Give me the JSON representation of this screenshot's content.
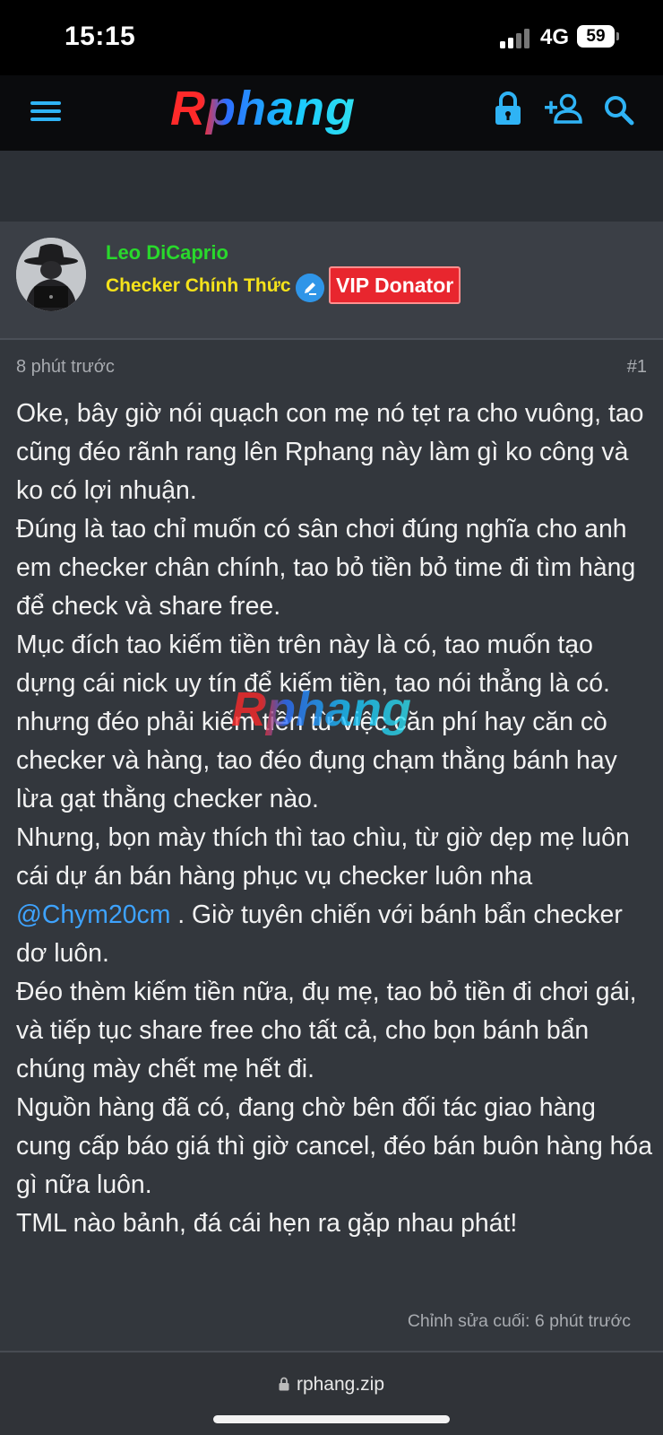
{
  "status_bar": {
    "time": "15:15",
    "network": "4G",
    "battery": "59"
  },
  "navbar": {
    "logo_text": "Rphang",
    "icons": [
      "menu-icon",
      "lock-icon",
      "add-user-icon",
      "search-icon"
    ],
    "accent_color": "#2fb3f5"
  },
  "post_header": {
    "username": "Leo DiCaprio",
    "user_title": "Checker Chính Thức",
    "badge_label": "VIP Donator"
  },
  "post": {
    "time": "8 phút trước",
    "number": "#1",
    "paragraphs": [
      "Oke, bây giờ nói quạch con mẹ nó tẹt ra cho vuông, tao cũng đéo rãnh rang lên Rphang này làm gì ko công và ko có lợi nhuận.",
      "Đúng là tao chỉ muốn có sân chơi đúng nghĩa cho anh em checker chân chính, tao bỏ tiền bỏ time đi tìm hàng để check và share free.",
      "Mục đích tao kiếm tiền trên này là có, tao muốn tạo dựng cái nick uy tín để kiếm tiền, tao nói thẳng là có.",
      "nhưng đéo phải kiếm tiền từ việc căn phí hay căn cò checker và hàng, tao đéo đụng chạm thằng bánh hay lừa gạt thằng checker nào.",
      "Nhưng, bọn mày thích thì tao chìu, từ giờ dẹp mẹ luôn cái dự án bán hàng phục vụ checker luôn nha"
    ],
    "mention": "@Chym20cm",
    "after_mention": " . Giờ tuyên chiến với bánh bẩn checker dơ luôn.",
    "paragraphs_end": [
      "Đéo thèm kiếm tiền nữa, đụ mẹ, tao bỏ tiền đi chơi gái, và tiếp tục share free cho tất cả, cho bọn bánh bẩn chúng mày chết mẹ hết đi.",
      "Nguồn hàng đã có, đang chờ bên đối tác giao hàng cung cấp báo giá thì giờ cancel, đéo bán buôn hàng hóa gì nữa luôn.",
      "TML nào bảnh, đá cái hẹn ra gặp nhau phát!"
    ],
    "watermark": "Rphang",
    "edited_note": "Chỉnh sửa cuối: 6 phút trước"
  },
  "browser": {
    "url": "rphang.zip"
  }
}
